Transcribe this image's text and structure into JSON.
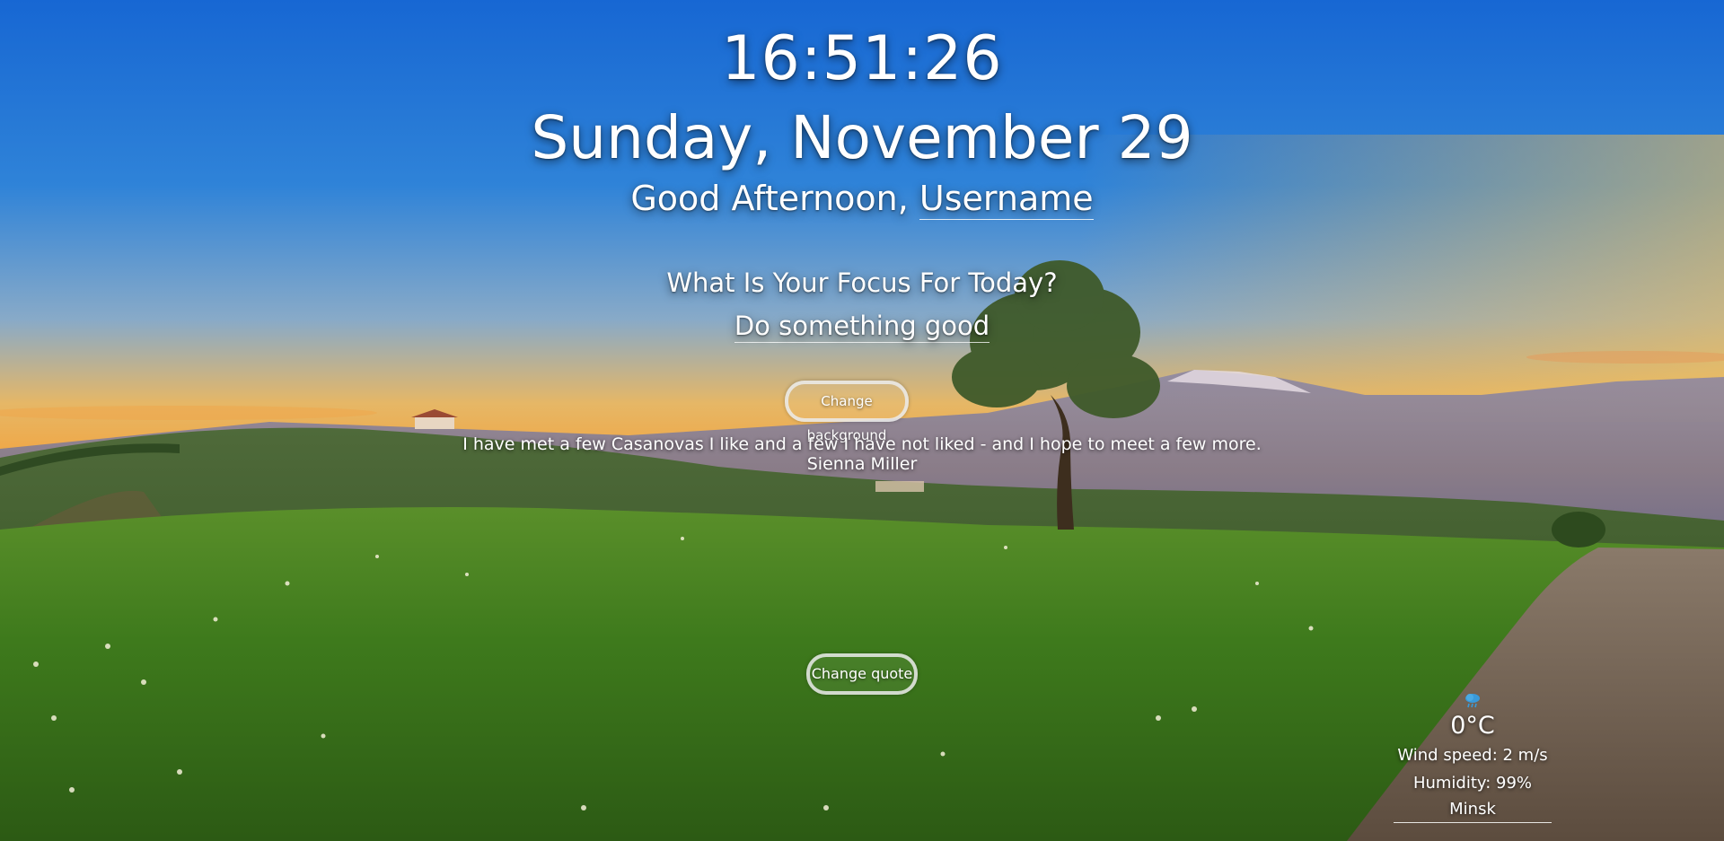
{
  "clock": {
    "time": "16:51:26",
    "date": "Sunday, November 29"
  },
  "greeting": {
    "prefix": "Good Afternoon,",
    "name": "Username"
  },
  "focus": {
    "question": "What Is Your Focus For Today?",
    "answer": "Do something good"
  },
  "buttons": {
    "change_background": "Change background",
    "change_quote": "Change quote"
  },
  "quote": {
    "text": "I have met a few Casanovas I like and a few I have not liked - and I hope to meet a few more.",
    "author": "Sienna Miller"
  },
  "weather": {
    "icon": "rain-cloud-icon",
    "temperature": "0°C",
    "wind": "Wind speed: 2 m/s",
    "humidity": "Humidity: 99%",
    "city": "Minsk"
  },
  "colors": {
    "sky_top": "#1a6fd6",
    "sky_horizon": "#f7b046",
    "grass": "#3c7a1e",
    "road": "#6b5a49"
  }
}
